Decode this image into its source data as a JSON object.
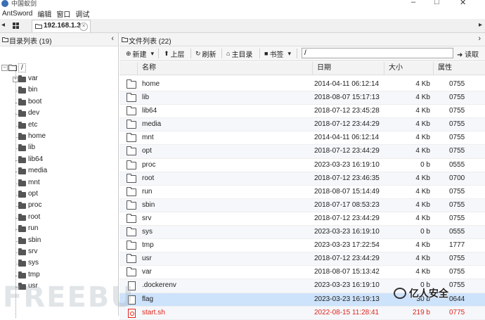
{
  "window": {
    "title": "中国蚁剑"
  },
  "menu": [
    "AntSword",
    "编辑",
    "窗口",
    "调试"
  ],
  "tab": {
    "label": "192.168.1.3"
  },
  "left_panel": {
    "header": "目录列表 (19)",
    "root": "/",
    "dirs": [
      "var",
      "bin",
      "boot",
      "dev",
      "etc",
      "home",
      "lib",
      "lib64",
      "media",
      "mnt",
      "opt",
      "proc",
      "root",
      "run",
      "sbin",
      "srv",
      "sys",
      "tmp",
      "usr"
    ]
  },
  "right_panel": {
    "header": "文件列表 (22)",
    "toolbar": {
      "new": "新建",
      "up": "上层",
      "refresh": "刷新",
      "home": "主目录",
      "bookmark": "书签",
      "path": "/",
      "read": "读取"
    },
    "columns": {
      "name": "名称",
      "date": "日期",
      "size": "大小",
      "perm": "属性"
    },
    "rows": [
      {
        "name": "home",
        "date": "2014-04-11 06:12:14",
        "size": "4 Kb",
        "perm": "0755",
        "type": "dir"
      },
      {
        "name": "lib",
        "date": "2018-08-07 15:17:13",
        "size": "4 Kb",
        "perm": "0755",
        "type": "dir"
      },
      {
        "name": "lib64",
        "date": "2018-07-12 23:45:28",
        "size": "4 Kb",
        "perm": "0755",
        "type": "dir"
      },
      {
        "name": "media",
        "date": "2018-07-12 23:44:29",
        "size": "4 Kb",
        "perm": "0755",
        "type": "dir"
      },
      {
        "name": "mnt",
        "date": "2014-04-11 06:12:14",
        "size": "4 Kb",
        "perm": "0755",
        "type": "dir"
      },
      {
        "name": "opt",
        "date": "2018-07-12 23:44:29",
        "size": "4 Kb",
        "perm": "0755",
        "type": "dir"
      },
      {
        "name": "proc",
        "date": "2023-03-23 16:19:10",
        "size": "0 b",
        "perm": "0555",
        "type": "dir"
      },
      {
        "name": "root",
        "date": "2018-07-12 23:46:35",
        "size": "4 Kb",
        "perm": "0700",
        "type": "dir"
      },
      {
        "name": "run",
        "date": "2018-08-07 15:14:49",
        "size": "4 Kb",
        "perm": "0755",
        "type": "dir"
      },
      {
        "name": "sbin",
        "date": "2018-07-17 08:53:23",
        "size": "4 Kb",
        "perm": "0755",
        "type": "dir"
      },
      {
        "name": "srv",
        "date": "2018-07-12 23:44:29",
        "size": "4 Kb",
        "perm": "0755",
        "type": "dir"
      },
      {
        "name": "sys",
        "date": "2023-03-23 16:19:10",
        "size": "0 b",
        "perm": "0555",
        "type": "dir"
      },
      {
        "name": "tmp",
        "date": "2023-03-23 17:22:54",
        "size": "4 Kb",
        "perm": "1777",
        "type": "dir"
      },
      {
        "name": "usr",
        "date": "2018-07-12 23:44:29",
        "size": "4 Kb",
        "perm": "0755",
        "type": "dir"
      },
      {
        "name": "var",
        "date": "2018-08-07 15:13:42",
        "size": "4 Kb",
        "perm": "0755",
        "type": "dir"
      },
      {
        "name": ".dockerenv",
        "date": "2023-03-23 16:19:10",
        "size": "0 b",
        "perm": "0755",
        "type": "file"
      },
      {
        "name": "flag",
        "date": "2023-03-23 16:19:13",
        "size": "30 b",
        "perm": "0644",
        "type": "file",
        "selected": true
      },
      {
        "name": "start.sh",
        "date": "2022-08-15 11:28:41",
        "size": "219 b",
        "perm": "0775",
        "type": "script",
        "red": true
      }
    ]
  },
  "watermark": {
    "left": "FREEBU",
    "right": "亿人安全"
  },
  "colors": {
    "selected_row": "#cde2fb",
    "red_text": "#e2231a"
  }
}
